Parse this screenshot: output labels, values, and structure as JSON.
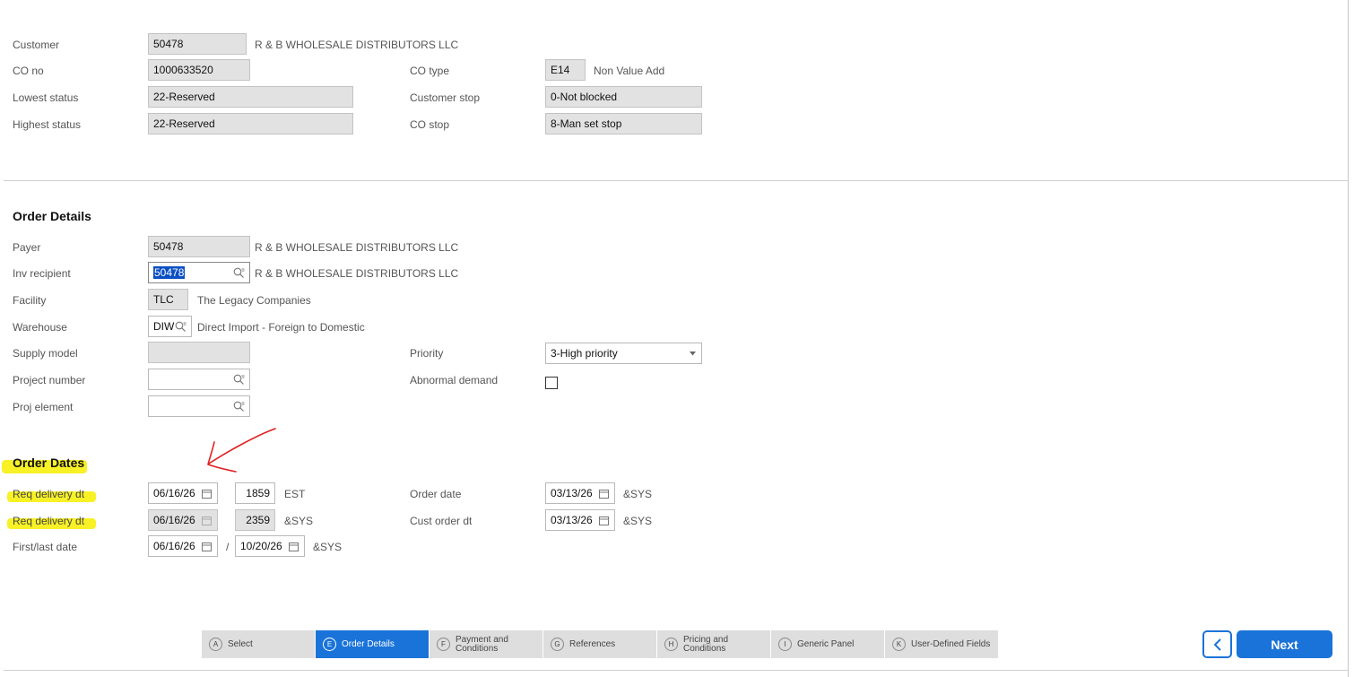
{
  "header": {
    "customer_label": "Customer",
    "customer_value": "50478",
    "customer_name": "R & B WHOLESALE DISTRIBUTORS LLC",
    "co_no_label": "CO no",
    "co_no_value": "1000633520",
    "lowest_status_label": "Lowest status",
    "lowest_status_value": "22-Reserved",
    "highest_status_label": "Highest status",
    "highest_status_value": "22-Reserved",
    "co_type_label": "CO type",
    "co_type_value": "E14",
    "co_type_desc": "Non Value Add",
    "customer_stop_label": "Customer stop",
    "customer_stop_value": "0-Not blocked",
    "co_stop_label": "CO stop",
    "co_stop_value": "8-Man set stop"
  },
  "order_details": {
    "title": "Order Details",
    "payer_label": "Payer",
    "payer_value": "50478",
    "payer_name": "R & B WHOLESALE DISTRIBUTORS LLC",
    "inv_recipient_label": "Inv recipient",
    "inv_recipient_value": "50478",
    "inv_recipient_name": "R & B WHOLESALE DISTRIBUTORS LLC",
    "facility_label": "Facility",
    "facility_value": "TLC",
    "facility_name": "The Legacy Companies",
    "warehouse_label": "Warehouse",
    "warehouse_value": "DIW",
    "warehouse_name": "Direct Import - Foreign to Domestic",
    "supply_model_label": "Supply model",
    "supply_model_value": "",
    "project_number_label": "Project number",
    "project_number_value": "",
    "proj_element_label": "Proj element",
    "proj_element_value": "",
    "priority_label": "Priority",
    "priority_value": "3-High priority",
    "abnormal_demand_label": "Abnormal demand"
  },
  "order_dates": {
    "title": "Order Dates",
    "req_delivery_label": "Req delivery dt",
    "req_delivery_date": "06/16/26",
    "req_delivery_time": "1859",
    "req_delivery_tz": "EST",
    "req_delivery2_label": "Req delivery dt",
    "req_delivery2_date": "06/16/26",
    "req_delivery2_time": "2359",
    "req_delivery2_tz": "&SYS",
    "first_last_label": "First/last date",
    "first_date": "06/16/26",
    "separator": "/",
    "last_date": "10/20/26",
    "first_last_tz": "&SYS",
    "order_date_label": "Order date",
    "order_date_value": "03/13/26",
    "order_date_tz": "&SYS",
    "cust_order_label": "Cust order dt",
    "cust_order_value": "03/13/26",
    "cust_order_tz": "&SYS"
  },
  "wizard": {
    "steps": [
      {
        "key": "A",
        "label": "Select"
      },
      {
        "key": "E",
        "label": "Order Details"
      },
      {
        "key": "F",
        "label": "Payment and Conditions"
      },
      {
        "key": "G",
        "label": "References"
      },
      {
        "key": "H",
        "label": "Pricing and Conditions"
      },
      {
        "key": "I",
        "label": "Generic Panel"
      },
      {
        "key": "K",
        "label": "User-Defined Fields"
      }
    ],
    "active_step": "E",
    "next_label": "Next"
  },
  "annotation": {
    "arrow_color": "#e02020",
    "highlight_color": "#f7ef00"
  },
  "colors": {
    "accent": "#1a73d8"
  }
}
